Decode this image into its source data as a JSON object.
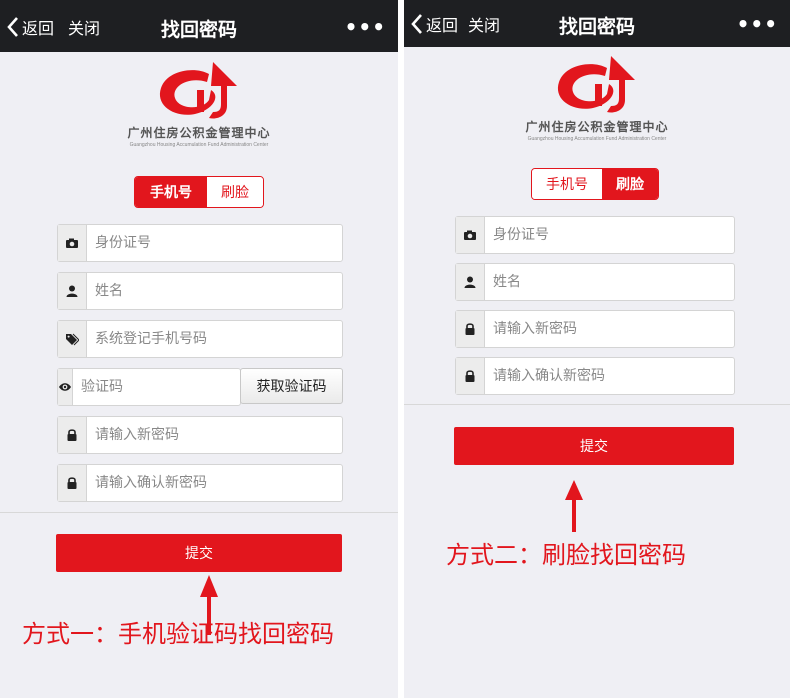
{
  "colors": {
    "accent": "#e2161d",
    "topbar": "#1e1f22",
    "page_bg": "#efeff4"
  },
  "logo": {
    "cn": "广州住房公积金管理中心",
    "en": "Guangzhou Housing Accumulation Fund Administration Center"
  },
  "left": {
    "nav": {
      "back": "返回",
      "close": "关闭",
      "title": "找回密码",
      "more": "•••"
    },
    "tabs": [
      {
        "label": "手机号",
        "active": true
      },
      {
        "label": "刷脸",
        "active": false
      }
    ],
    "fields": [
      {
        "icon": "camera-icon",
        "placeholder": "身份证号"
      },
      {
        "icon": "user-icon",
        "placeholder": "姓名"
      },
      {
        "icon": "tag-icon",
        "placeholder": "系统登记手机号码"
      },
      {
        "icon": "eye-icon",
        "placeholder": "验证码"
      },
      {
        "icon": "lock-icon",
        "placeholder": "请输入新密码"
      },
      {
        "icon": "lock-icon",
        "placeholder": "请输入确认新密码"
      }
    ],
    "get_code": "获取验证码",
    "submit": "提交",
    "caption": "方式一：手机验证码找回密码"
  },
  "right": {
    "nav": {
      "back": "返回",
      "close": "关闭",
      "title": "找回密码",
      "more": "•••"
    },
    "tabs": [
      {
        "label": "手机号",
        "active": false
      },
      {
        "label": "刷脸",
        "active": true
      }
    ],
    "fields": [
      {
        "icon": "camera-icon",
        "placeholder": "身份证号"
      },
      {
        "icon": "user-icon",
        "placeholder": "姓名"
      },
      {
        "icon": "lock-icon",
        "placeholder": "请输入新密码"
      },
      {
        "icon": "lock-icon",
        "placeholder": "请输入确认新密码"
      }
    ],
    "submit": "提交",
    "caption": "方式二：刷脸找回密码"
  }
}
